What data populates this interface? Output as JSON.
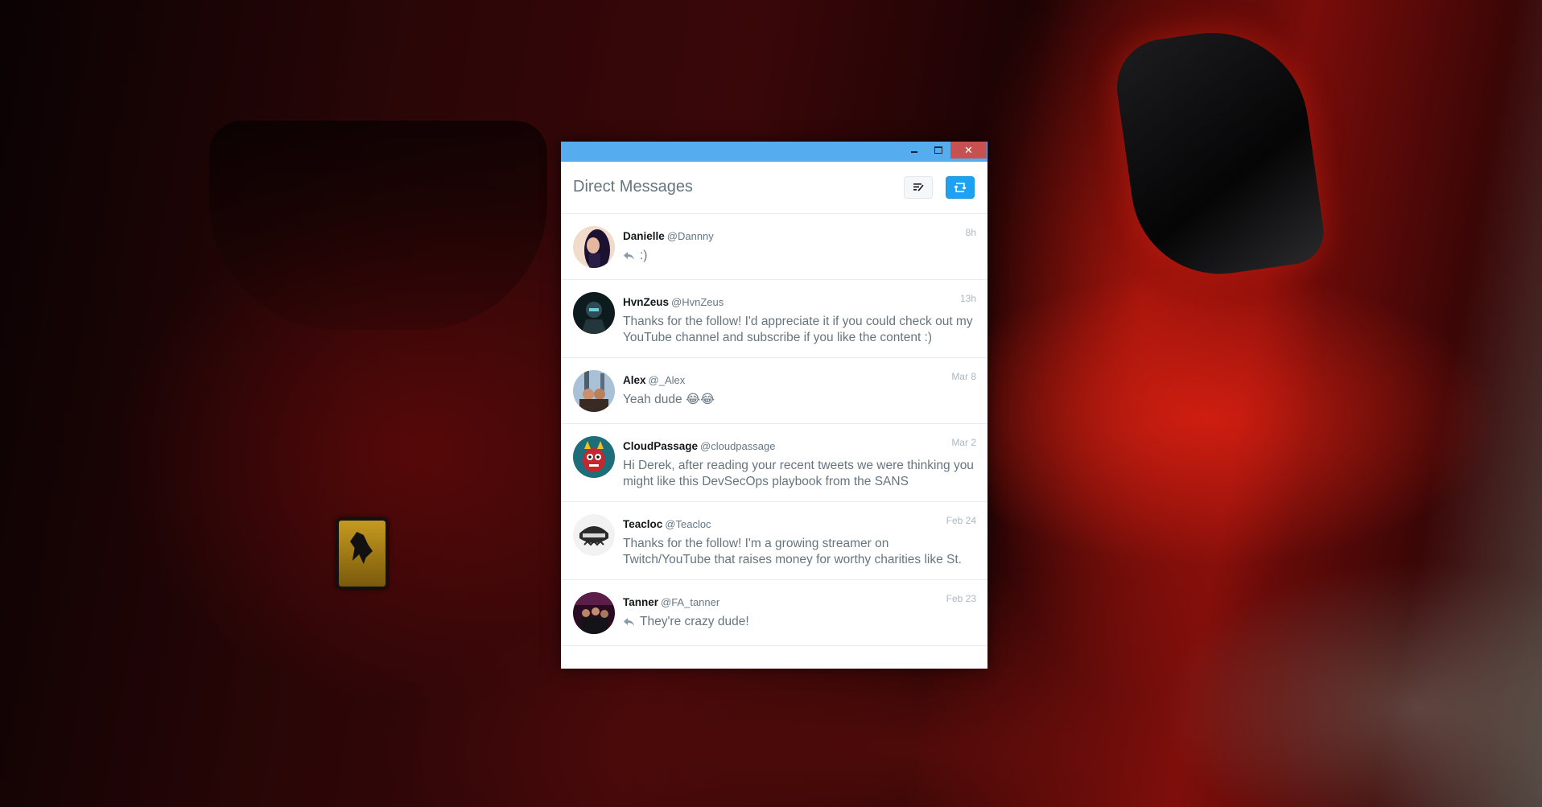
{
  "window": {
    "min_label": "–",
    "max_label": "☐",
    "close_label": "✕"
  },
  "header": {
    "title": "Direct Messages",
    "mark_read_icon": "mark-all-read-icon",
    "new_message_icon": "new-message-icon"
  },
  "colors": {
    "titlebar": "#55acee",
    "close_button": "#c75050",
    "accent": "#1da1f2",
    "name": "#14171a",
    "text": "#66757f",
    "time": "#aab8c2"
  },
  "conversations": [
    {
      "name": "Danielle",
      "handle": "@Dannny",
      "time": "8h",
      "text": ":)",
      "replied": true
    },
    {
      "name": "HvnZeus",
      "handle": "@HvnZeus",
      "time": "13h",
      "text": "Thanks for the follow! I'd appreciate it if you could check out my YouTube channel and subscribe if you like the content :)",
      "replied": false
    },
    {
      "name": "Alex",
      "handle": "@_Alex",
      "time": "Mar 8",
      "text": "Yeah dude 😂😂",
      "replied": false
    },
    {
      "name": "CloudPassage",
      "handle": "@cloudpassage",
      "time": "Mar 2",
      "text": "Hi Derek, after reading your recent tweets we were thinking you might like this DevSecOps playbook from the SANS",
      "replied": false
    },
    {
      "name": "Teacloc",
      "handle": "@Teacloc",
      "time": "Feb 24",
      "text": "Thanks for the follow! I'm a growing streamer on Twitch/YouTube that raises money for worthy charities like St.",
      "replied": false
    },
    {
      "name": "Tanner",
      "handle": "@FA_tanner",
      "time": "Feb 23",
      "text": "They're crazy dude!",
      "replied": true
    }
  ]
}
